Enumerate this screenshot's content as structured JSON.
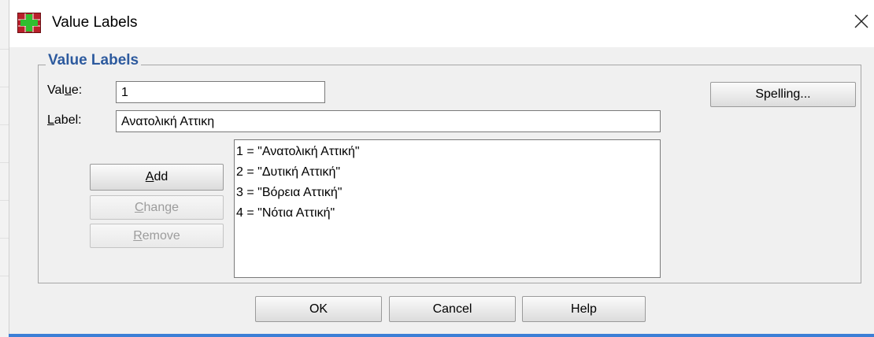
{
  "window": {
    "title": "Value Labels",
    "close_icon": "close-icon"
  },
  "group": {
    "title": "Value Labels"
  },
  "value_field": {
    "label_before": "Val",
    "label_accel": "u",
    "label_after": "e:",
    "value": "1"
  },
  "label_field": {
    "label_accel": "L",
    "label_after": "abel:",
    "value": "Ανατολική Αττικη"
  },
  "buttons": {
    "spelling": "Spelling...",
    "add_accel": "A",
    "add_rest": "dd",
    "change_accel": "C",
    "change_rest": "hange",
    "remove_accel": "R",
    "remove_rest": "emove",
    "ok": "OK",
    "cancel": "Cancel",
    "help": "Help"
  },
  "list": {
    "items": [
      {
        "text": "1 = \"Ανατολική Αττική\""
      },
      {
        "text": "2 = \"Δυτική Αττική\""
      },
      {
        "text": "3 = \"Βόρεια Αττική\""
      },
      {
        "text": "4 = \"Νότια Αττική\""
      }
    ]
  },
  "colors": {
    "group_title": "#2d5a9e",
    "dialog_bg": "#f0f0f0",
    "window_border": "#3c7fd6"
  }
}
